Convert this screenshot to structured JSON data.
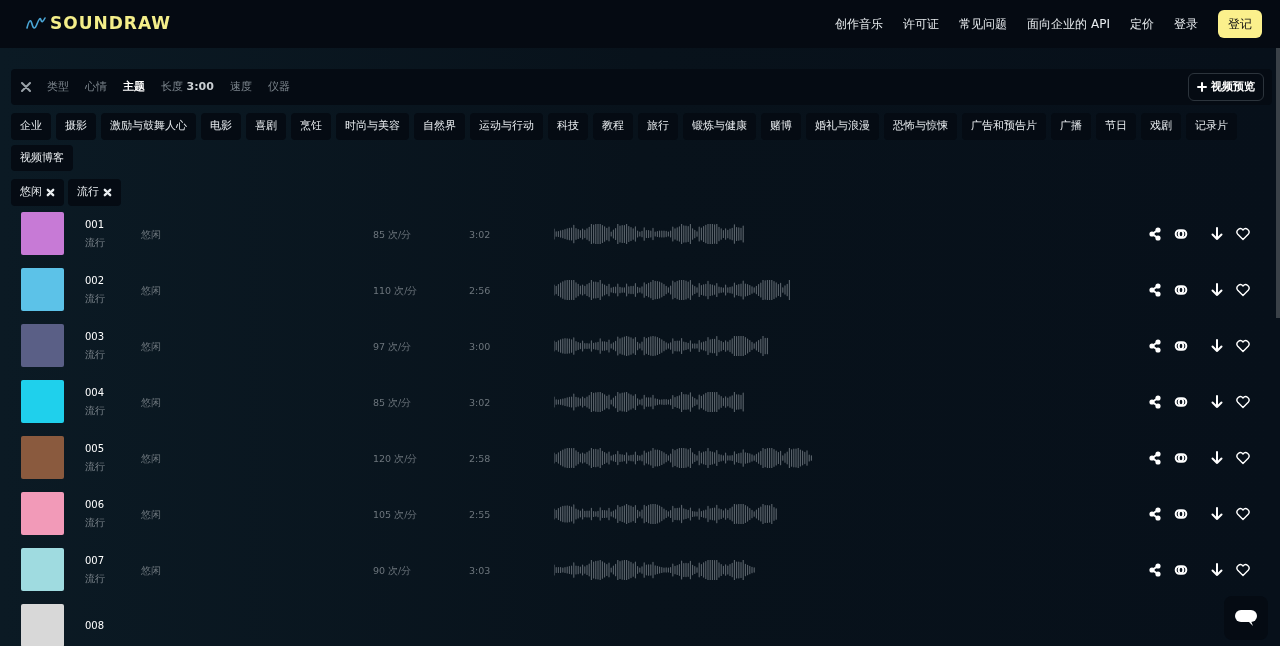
{
  "brand": {
    "name": "SOUNDRAW"
  },
  "nav": {
    "links": [
      "创作音乐",
      "许可证",
      "常见问题",
      "面向企业的 API",
      "定价",
      "登录"
    ],
    "cta": "登记"
  },
  "filter_bar": {
    "tabs": [
      {
        "label": "类型",
        "selected": false
      },
      {
        "label": "心情",
        "selected": false
      },
      {
        "label": "主题",
        "selected": true
      },
      {
        "label": "长度",
        "value": "3:00",
        "selected": false
      },
      {
        "label": "速度",
        "selected": false
      },
      {
        "label": "仪器",
        "selected": false
      }
    ],
    "video_preview_button": "视频预览"
  },
  "categories": [
    "企业",
    "摄影",
    "激励与鼓舞人心",
    "电影",
    "喜剧",
    "烹饪",
    "时尚与美容",
    "自然界",
    "运动与行动",
    "科技",
    "教程",
    "旅行",
    "锻炼与健康",
    "赌博",
    "婚礼与浪漫",
    "恐怖与惊悚",
    "广告和预告片",
    "广播",
    "节日",
    "戏剧",
    "记录片",
    "视频博客"
  ],
  "active_filters": [
    "悠闲",
    "流行"
  ],
  "tracks": [
    {
      "number": "001",
      "genre": "流行",
      "mood": "悠闲",
      "tempo": "85 次/分",
      "duration": "3:02",
      "color": "#c77ad6"
    },
    {
      "number": "002",
      "genre": "流行",
      "mood": "悠闲",
      "tempo": "110 次/分",
      "duration": "2:56",
      "color": "#5cc2e8"
    },
    {
      "number": "003",
      "genre": "流行",
      "mood": "悠闲",
      "tempo": "97 次/分",
      "duration": "3:00",
      "color": "#5a5f86"
    },
    {
      "number": "004",
      "genre": "流行",
      "mood": "悠闲",
      "tempo": "85 次/分",
      "duration": "3:02",
      "color": "#1fd0ec"
    },
    {
      "number": "005",
      "genre": "流行",
      "mood": "悠闲",
      "tempo": "120 次/分",
      "duration": "2:58",
      "color": "#8a5a3e"
    },
    {
      "number": "006",
      "genre": "流行",
      "mood": "悠闲",
      "tempo": "105 次/分",
      "duration": "2:55",
      "color": "#f29ab8"
    },
    {
      "number": "007",
      "genre": "流行",
      "mood": "悠闲",
      "tempo": "90 次/分",
      "duration": "3:03",
      "color": "#9fdbe0"
    },
    {
      "number": "008",
      "color": "#d8d8d8"
    }
  ]
}
